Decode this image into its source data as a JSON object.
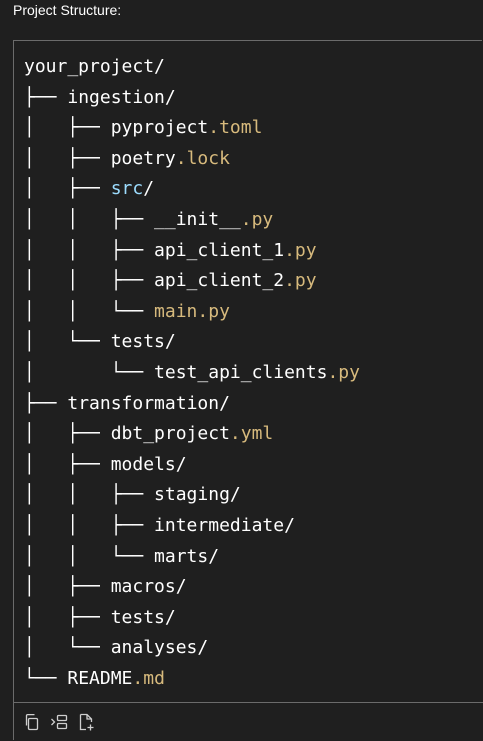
{
  "header": {
    "title": "Project Structure:"
  },
  "code": {
    "lines": [
      {
        "prefix": "",
        "name": "your_project/",
        "ext": "",
        "style": "normal"
      },
      {
        "prefix": "├── ",
        "name": "ingestion/",
        "ext": "",
        "style": "normal"
      },
      {
        "prefix": "│   ├── ",
        "name": "pyproject",
        "ext": ".toml",
        "style": "normal"
      },
      {
        "prefix": "│   ├── ",
        "name": "poetry",
        "ext": ".lock",
        "style": "normal"
      },
      {
        "prefix": "│   ├── ",
        "name": "src",
        "ext": "/",
        "style": "src"
      },
      {
        "prefix": "│   │   ├── ",
        "name": "__init__",
        "ext": ".py",
        "style": "normal"
      },
      {
        "prefix": "│   │   ├── ",
        "name": "api_client_1",
        "ext": ".py",
        "style": "normal"
      },
      {
        "prefix": "│   │   ├── ",
        "name": "api_client_2",
        "ext": ".py",
        "style": "normal"
      },
      {
        "prefix": "│   │   └── ",
        "name": "main.py",
        "ext": "",
        "style": "gold"
      },
      {
        "prefix": "│   └── ",
        "name": "tests/",
        "ext": "",
        "style": "normal"
      },
      {
        "prefix": "│       └── ",
        "name": "test_api_clients",
        "ext": ".py",
        "style": "normal"
      },
      {
        "prefix": "├── ",
        "name": "transformation/",
        "ext": "",
        "style": "normal"
      },
      {
        "prefix": "│   ├── ",
        "name": "dbt_project",
        "ext": ".yml",
        "style": "normal"
      },
      {
        "prefix": "│   ├── ",
        "name": "models/",
        "ext": "",
        "style": "normal"
      },
      {
        "prefix": "│   │   ├── ",
        "name": "staging/",
        "ext": "",
        "style": "normal"
      },
      {
        "prefix": "│   │   ├── ",
        "name": "intermediate/",
        "ext": "",
        "style": "normal"
      },
      {
        "prefix": "│   │   └── ",
        "name": "marts/",
        "ext": "",
        "style": "normal"
      },
      {
        "prefix": "│   ├── ",
        "name": "macros/",
        "ext": "",
        "style": "normal"
      },
      {
        "prefix": "│   ├── ",
        "name": "tests/",
        "ext": "",
        "style": "normal"
      },
      {
        "prefix": "│   └── ",
        "name": "analyses/",
        "ext": "",
        "style": "normal"
      },
      {
        "prefix": "└── ",
        "name": "README",
        "ext": ".md",
        "style": "normal"
      }
    ]
  },
  "toolbar": {
    "buttons": [
      {
        "icon": "copy-icon"
      },
      {
        "icon": "insert-icon"
      },
      {
        "icon": "new-file-icon"
      }
    ]
  },
  "colors": {
    "background": "#1f1f1f",
    "text": "#ffffff",
    "extension": "#d7ba7d",
    "folder_src": "#9cdcfe",
    "border": "#6b6b6b"
  }
}
